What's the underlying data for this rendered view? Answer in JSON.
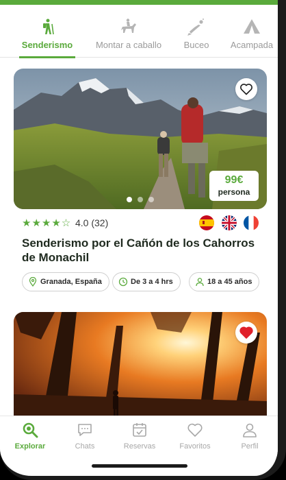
{
  "colors": {
    "accent": "#5aaa3c",
    "text": "#1f2a1f",
    "muted": "#a7a7a7",
    "favorite": "#e0202a"
  },
  "tabs": [
    {
      "label": "Senderismo",
      "icon": "hiker-icon",
      "active": true
    },
    {
      "label": "Montar a caballo",
      "icon": "horse-rider-icon",
      "active": false
    },
    {
      "label": "Buceo",
      "icon": "diver-icon",
      "active": false
    },
    {
      "label": "Acampada",
      "icon": "tent-icon",
      "active": false
    }
  ],
  "cards": [
    {
      "favorite": false,
      "price": "99€",
      "price_unit": "persona",
      "stars": "★★★★☆",
      "rating": "4.0 (32)",
      "languages": [
        "spanish-flag-icon",
        "uk-flag-icon",
        "french-flag-icon"
      ],
      "title": "Senderismo por el Cañón de los Cahorros de Monachil",
      "location": "Granada, España",
      "duration": "De 3 a 4 hrs",
      "ages": "18 a 45 años",
      "slide": 1,
      "slides_total": 3
    },
    {
      "favorite": true
    }
  ],
  "bottom_nav": [
    {
      "label": "Explorar",
      "icon": "search-icon",
      "active": true
    },
    {
      "label": "Chats",
      "icon": "chat-icon",
      "active": false
    },
    {
      "label": "Reservas",
      "icon": "calendar-check-icon",
      "active": false
    },
    {
      "label": "Favoritos",
      "icon": "heart-icon",
      "active": false
    },
    {
      "label": "Perfil",
      "icon": "user-icon",
      "active": false
    }
  ]
}
